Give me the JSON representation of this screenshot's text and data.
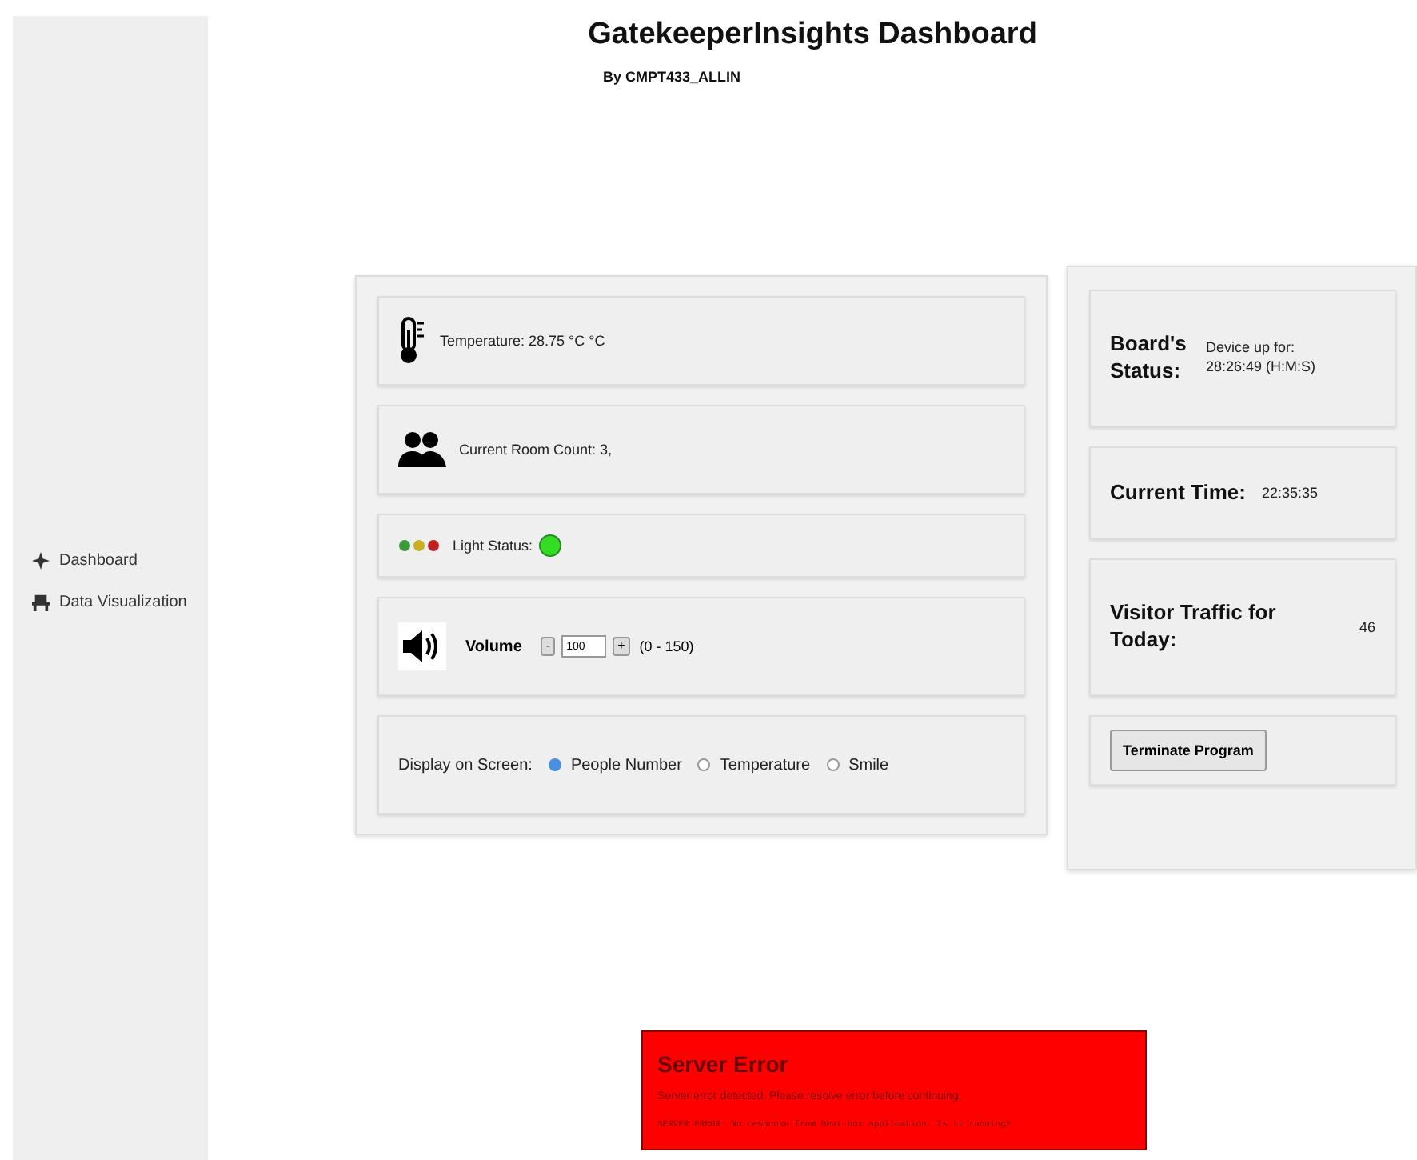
{
  "sidebar": {
    "items": [
      {
        "label": "Dashboard"
      },
      {
        "label": "Data Visualization"
      }
    ]
  },
  "header": {
    "title": "GatekeeperInsights Dashboard",
    "subtitle": "By CMPT433_ALLIN"
  },
  "sensors": {
    "temperature": "Temperature: 28.75 °C °C",
    "room_count": "Current Room Count: 3,",
    "light_label": "Light Status:",
    "light_on": true,
    "volume": {
      "label": "Volume",
      "minus": "-",
      "value": "100",
      "plus": "+",
      "range": "(0 - 150)"
    },
    "display": {
      "label": "Display on Screen:",
      "options": [
        {
          "label": "People Number",
          "selected": true
        },
        {
          "label": "Temperature",
          "selected": false
        },
        {
          "label": "Smile",
          "selected": false
        }
      ]
    }
  },
  "status": {
    "board_label": "Board's Status:",
    "board_value": "Device up for: 28:26:49 (H:M:S)",
    "time_label": "Current Time:",
    "time_value": "22:35:35",
    "traffic_label": "Visitor Traffic for Today:",
    "traffic_value": "46",
    "terminate_button": "Terminate Program"
  },
  "error": {
    "title": "Server Error",
    "message": "Server error detected. Please resolve error before continuing.",
    "detail": "SERVER ERROR: No response from beat-box application. Is it running?"
  }
}
